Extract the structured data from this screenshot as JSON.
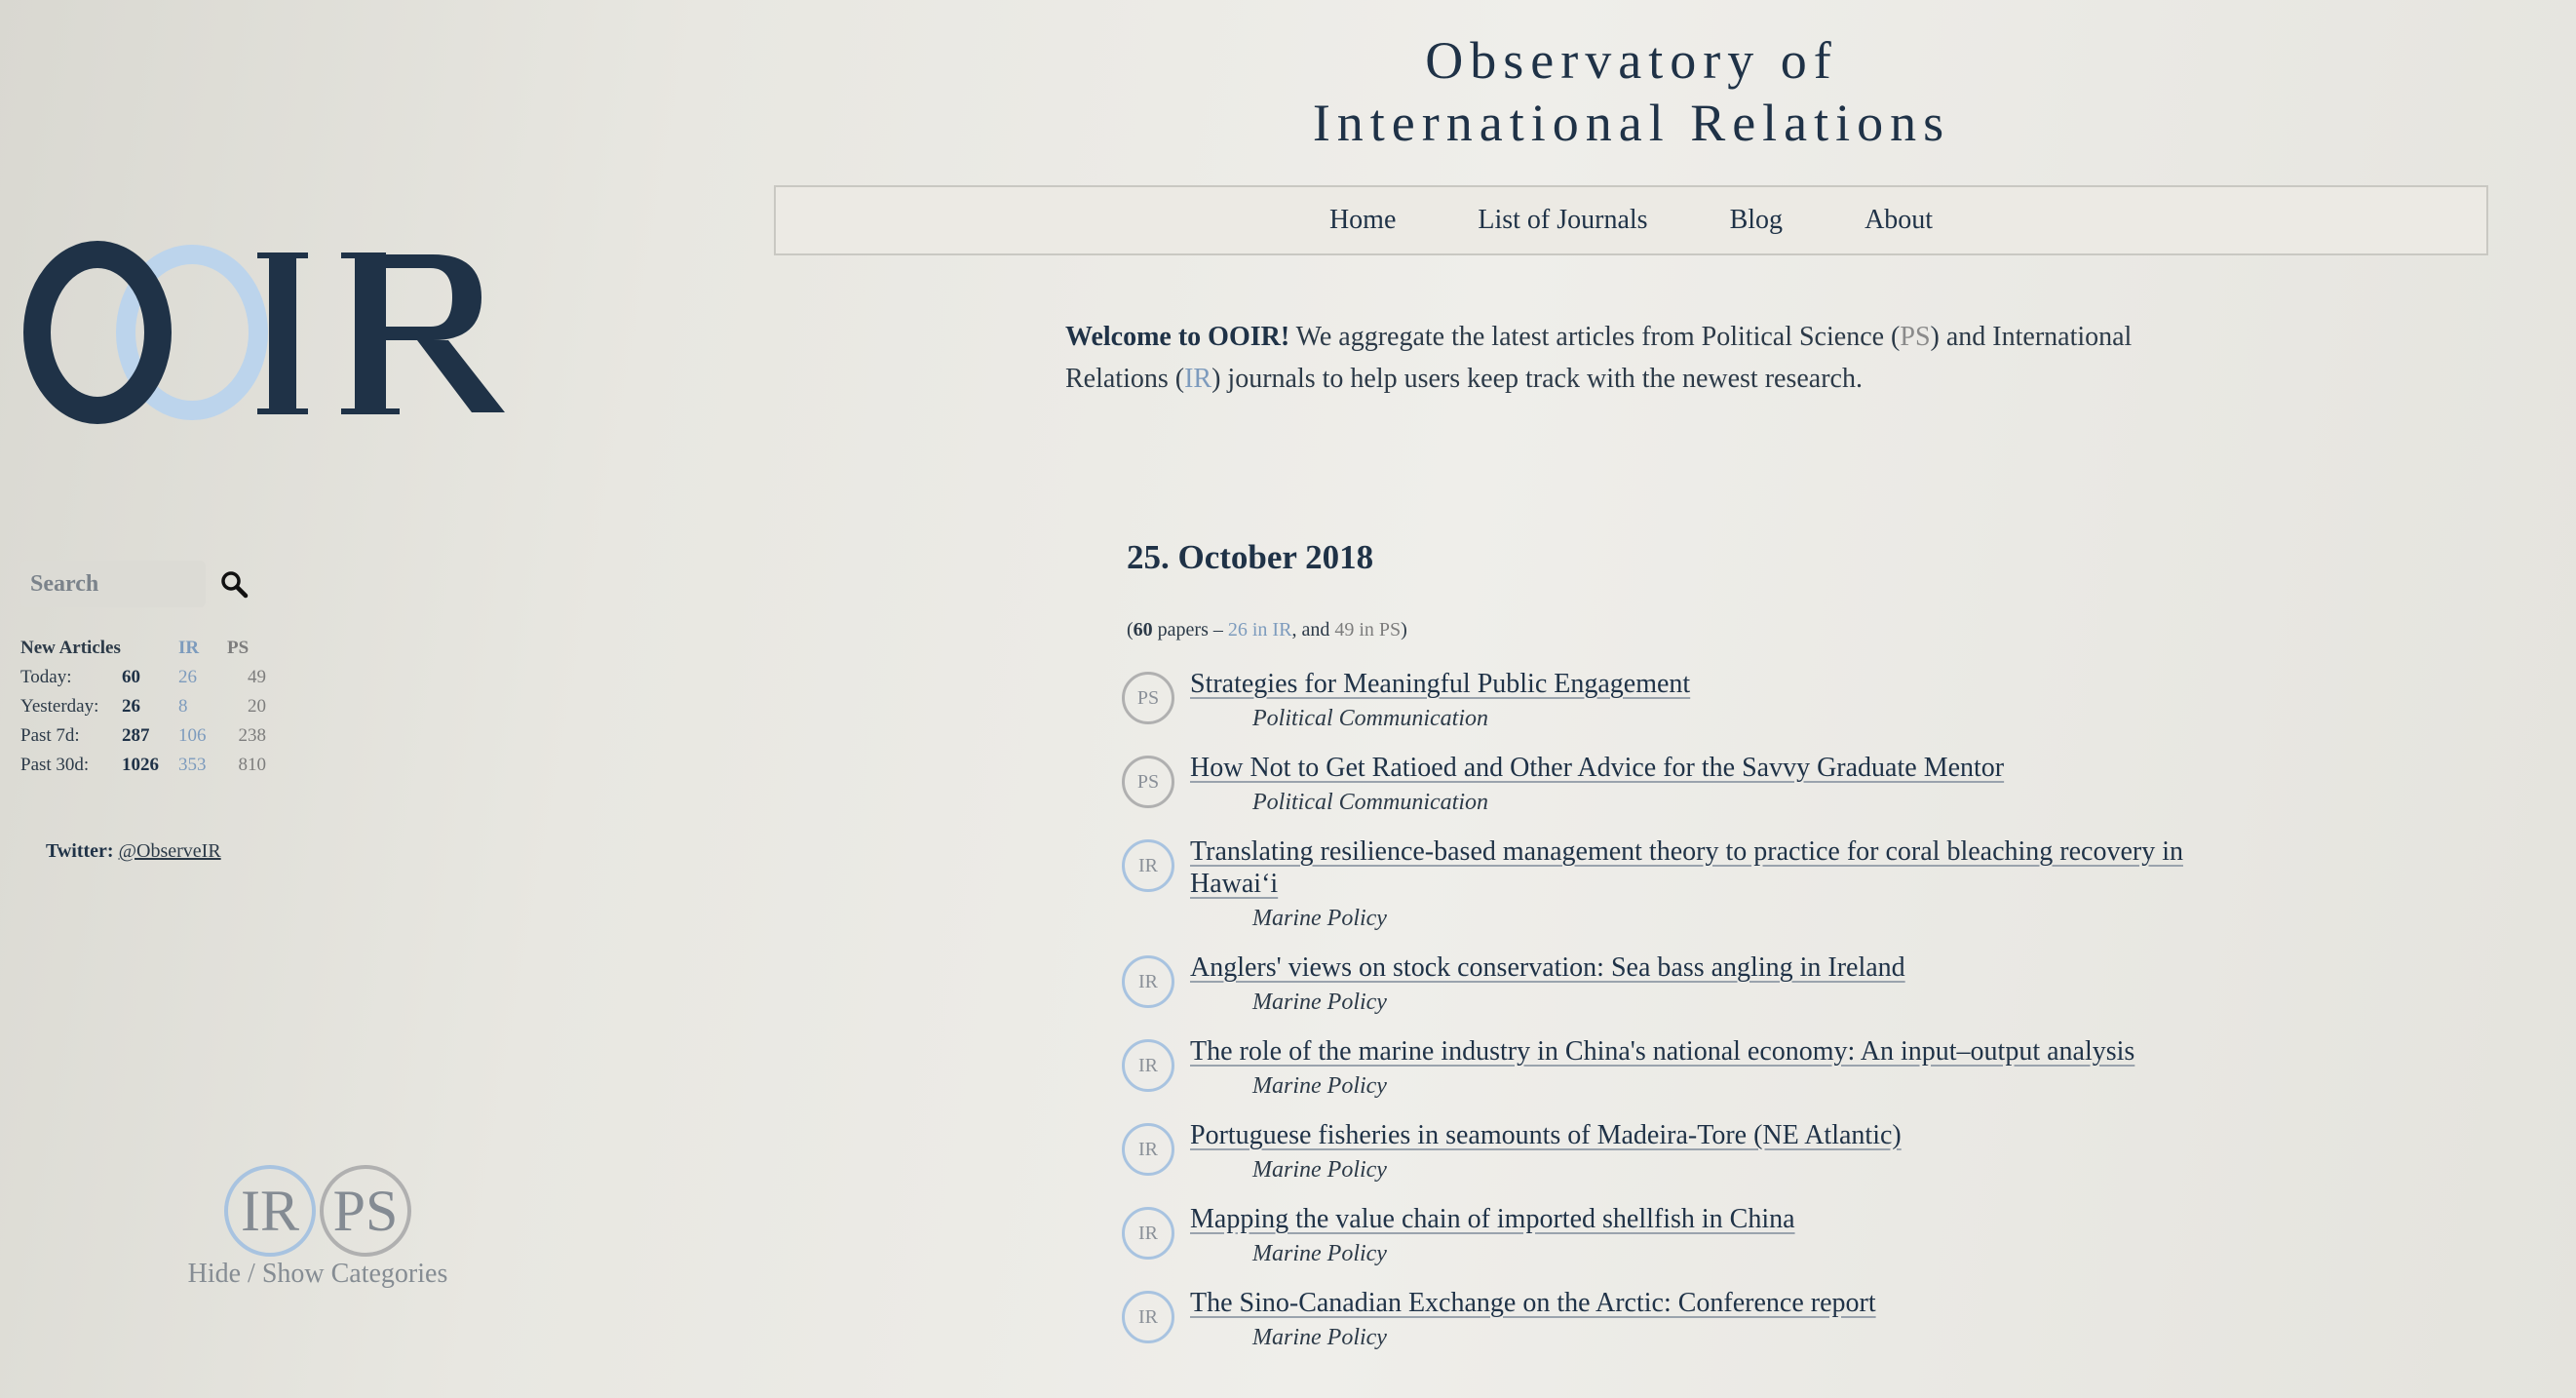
{
  "site": {
    "title_line1": "Observatory of",
    "title_line2": "International Relations",
    "logo_text": "OOIR"
  },
  "nav": [
    "Home",
    "List of Journals",
    "Blog",
    "About"
  ],
  "welcome": {
    "bold": "Welcome to OOIR!",
    "text1": " We aggregate the latest articles from Political Science (",
    "ps": "PS",
    "text2": ") and International Relations (",
    "ir": "IR",
    "text3": ") journals to help users keep track with the newest research."
  },
  "search": {
    "placeholder": "Search"
  },
  "stats": {
    "header": {
      "label": "New Articles",
      "ir": "IR",
      "ps": "PS"
    },
    "rows": [
      {
        "label": "Today:",
        "total": "60",
        "ir": "26",
        "ps": "49"
      },
      {
        "label": "Yesterday:",
        "total": "26",
        "ir": "8",
        "ps": "20"
      },
      {
        "label": "Past 7d:",
        "total": "287",
        "ir": "106",
        "ps": "238"
      },
      {
        "label": "Past 30d:",
        "total": "1026",
        "ir": "353",
        "ps": "810"
      }
    ]
  },
  "twitter": {
    "label": "Twitter:",
    "handle": "@ObserveIR"
  },
  "categories": {
    "ir": "IR",
    "ps": "PS",
    "label": "Hide / Show Categories"
  },
  "main": {
    "date": "25. October 2018",
    "count": {
      "open": "(",
      "total": "60",
      "papers": " papers – ",
      "ir_text": "26 in IR",
      "and": ", and ",
      "ps_text": "49 in PS",
      "close": ")"
    },
    "articles": [
      {
        "category": "PS",
        "title": "Strategies for Meaningful Public Engagement",
        "journal": "Political Communication"
      },
      {
        "category": "PS",
        "title": "How Not to Get Ratioed and Other Advice for the Savvy Graduate Mentor",
        "journal": "Political Communication"
      },
      {
        "category": "IR",
        "title": "Translating resilience-based management theory to practice for coral bleaching recovery in Hawaiʻi",
        "journal": "Marine Policy"
      },
      {
        "category": "IR",
        "title": "Anglers' views on stock conservation: Sea bass angling in Ireland",
        "journal": "Marine Policy"
      },
      {
        "category": "IR",
        "title": "The role of the marine industry in China's national economy: An input–output analysis",
        "journal": "Marine Policy"
      },
      {
        "category": "IR",
        "title": "Portuguese fisheries in seamounts of Madeira-Tore (NE Atlantic)",
        "journal": "Marine Policy"
      },
      {
        "category": "IR",
        "title": "Mapping the value chain of imported shellfish in China",
        "journal": "Marine Policy"
      },
      {
        "category": "IR",
        "title": "The Sino-Canadian Exchange on the Arctic: Conference report",
        "journal": "Marine Policy"
      }
    ]
  },
  "colors": {
    "navy": "#1f3247",
    "ir_blue": "#7d9bbd",
    "ir_ring": "#a8c3e0",
    "ps_gray": "#8a8a8a",
    "logo_light": "#bcd4ec"
  }
}
